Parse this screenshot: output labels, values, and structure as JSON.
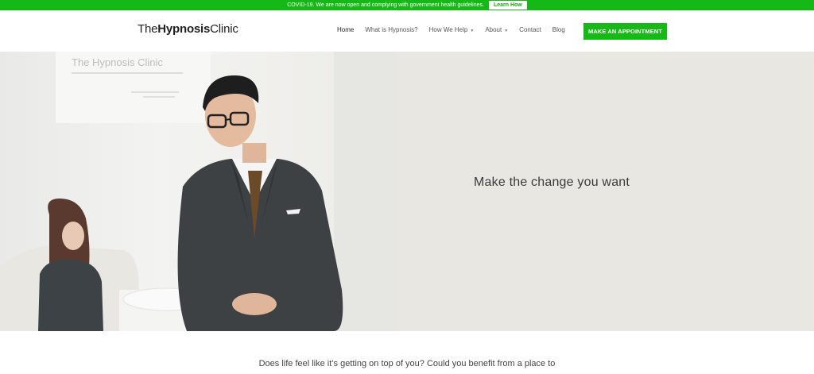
{
  "announcement": {
    "text": "COVID-19. We are now open and complying with government health guidelines.",
    "button_label": "Learn How"
  },
  "header": {
    "logo_regular_1": "The",
    "logo_bold": "Hypnosis",
    "logo_regular_2": "Clinic",
    "nav": [
      {
        "label": "Home",
        "active": true
      },
      {
        "label": "What is Hypnosis?"
      },
      {
        "label": "How We Help",
        "dropdown": true
      },
      {
        "label": "About",
        "dropdown": true
      },
      {
        "label": "Contact"
      },
      {
        "label": "Blog"
      }
    ],
    "cta_label": "MAKE AN APPOINTMENT"
  },
  "hero": {
    "headline": "Make the change you want",
    "wall_sign": "The Hypnosis Clinic"
  },
  "intro": {
    "text": "Does life feel like it’s getting on top of you? Could you benefit from a place to"
  },
  "colors": {
    "brand_green": "#16b816",
    "hero_bg": "#e8e7e2"
  }
}
